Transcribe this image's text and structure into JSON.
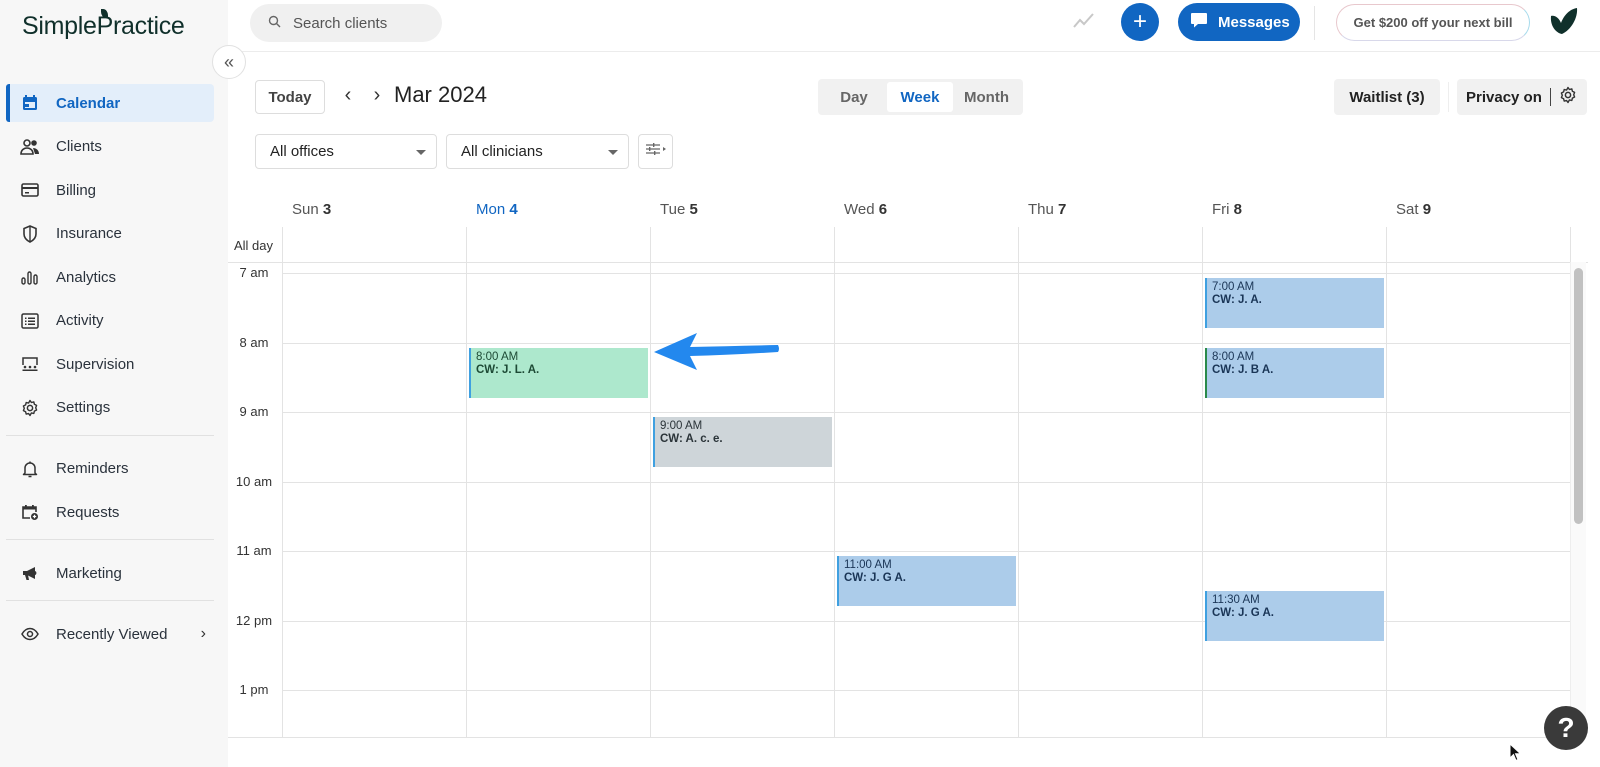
{
  "app": {
    "brand": "SimplePractice",
    "brand_color": "#1166c2"
  },
  "sidebar": {
    "collapse_icon": "double-chevron-left-icon",
    "items": [
      {
        "label": "Calendar",
        "icon": "calendar-icon",
        "active": true
      },
      {
        "label": "Clients",
        "icon": "clients-icon"
      },
      {
        "label": "Billing",
        "icon": "credit-card-icon"
      },
      {
        "label": "Insurance",
        "icon": "shield-icon"
      },
      {
        "label": "Analytics",
        "icon": "bar-chart-icon"
      },
      {
        "label": "Activity",
        "icon": "list-icon"
      },
      {
        "label": "Supervision",
        "icon": "supervision-icon"
      },
      {
        "label": "Settings",
        "icon": "gear-icon"
      }
    ],
    "secondary_items": [
      {
        "label": "Reminders",
        "icon": "bell-icon"
      },
      {
        "label": "Requests",
        "icon": "calendar-plus-icon"
      }
    ],
    "tertiary_items": [
      {
        "label": "Marketing",
        "icon": "megaphone-icon"
      }
    ],
    "recently_viewed": {
      "label": "Recently Viewed",
      "icon": "eye-icon"
    }
  },
  "topbar": {
    "search_placeholder": "Search clients",
    "messages_label": "Messages",
    "promo_label": "Get $200 off your next bill"
  },
  "toolbar": {
    "today_label": "Today",
    "prev": "‹",
    "next": "›",
    "month_title": "Mar 2024",
    "views": [
      {
        "label": "Day"
      },
      {
        "label": "Week",
        "selected": true
      },
      {
        "label": "Month"
      }
    ],
    "waitlist_label": "Waitlist (3)",
    "privacy_label": "Privacy on",
    "office_filter": "All offices",
    "clinician_filter": "All clinicians"
  },
  "calendar": {
    "allday_label": "All day",
    "days": [
      {
        "name": "Sun",
        "num": "3"
      },
      {
        "name": "Mon",
        "num": "4",
        "today": true
      },
      {
        "name": "Tue",
        "num": "5"
      },
      {
        "name": "Wed",
        "num": "6"
      },
      {
        "name": "Thu",
        "num": "7"
      },
      {
        "name": "Fri",
        "num": "8"
      },
      {
        "name": "Sat",
        "num": "9"
      }
    ],
    "hours": [
      "7 am",
      "8 am",
      "9 am",
      "10 am",
      "11 am",
      "12 pm",
      "1 pm"
    ],
    "events": [
      {
        "day": 1,
        "start": 8.0,
        "time": "8:00 AM",
        "name": "CW: J. L. A.",
        "style": "green"
      },
      {
        "day": 2,
        "start": 9.0,
        "time": "9:00 AM",
        "name": "CW: A. c. e.",
        "style": "gray"
      },
      {
        "day": 3,
        "start": 11.0,
        "time": "11:00 AM",
        "name": "CW: J. G A.",
        "style": "blue"
      },
      {
        "day": 5,
        "start": 7.0,
        "time": "7:00 AM",
        "name": "CW: J. A.",
        "style": "blue"
      },
      {
        "day": 5,
        "start": 8.0,
        "time": "8:00 AM",
        "name": "CW: J. B A.",
        "style": "blue dkgreen-border"
      },
      {
        "day": 5,
        "start": 11.5,
        "time": "11:30 AM",
        "name": "CW: J. G A.",
        "style": "blue"
      }
    ]
  },
  "help_label": "?"
}
